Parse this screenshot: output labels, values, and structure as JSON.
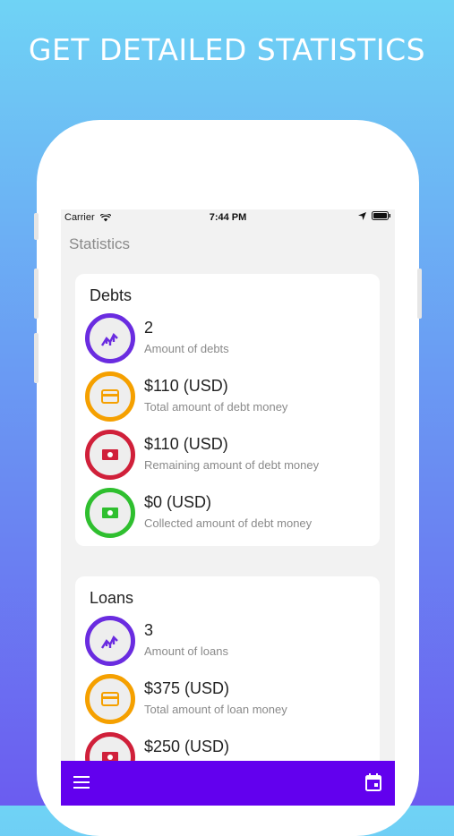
{
  "promo": {
    "headline": "GET DETAILED STATISTICS"
  },
  "status_bar": {
    "carrier": "Carrier",
    "time": "7:44 PM"
  },
  "nav": {
    "title": "Statistics"
  },
  "colors": {
    "accent": "#6200ee",
    "purple": "#6a2ce0",
    "orange": "#f5a000",
    "red": "#d0203a",
    "green": "#2fbf2f"
  },
  "debts": {
    "title": "Debts",
    "rows": [
      {
        "value": "2",
        "label": "Amount of debts",
        "icon": "chart-icon",
        "color": "purple"
      },
      {
        "value": "$110 (USD)",
        "label": "Total amount of debt money",
        "icon": "card-icon",
        "color": "orange"
      },
      {
        "value": "$110 (USD)",
        "label": "Remaining amount of debt money",
        "icon": "cash-icon",
        "color": "red"
      },
      {
        "value": "$0 (USD)",
        "label": "Collected amount of debt money",
        "icon": "cash-icon",
        "color": "green"
      }
    ]
  },
  "loans": {
    "title": "Loans",
    "rows": [
      {
        "value": "3",
        "label": "Amount of loans",
        "icon": "chart-icon",
        "color": "purple"
      },
      {
        "value": "$375 (USD)",
        "label": "Total amount of loan money",
        "icon": "card-icon",
        "color": "orange"
      },
      {
        "value": "$250 (USD)",
        "label": "",
        "icon": "cash-icon",
        "color": "red"
      }
    ]
  },
  "tabbar": {
    "left_icon": "menu-icon",
    "right_icon": "calendar-icon"
  }
}
